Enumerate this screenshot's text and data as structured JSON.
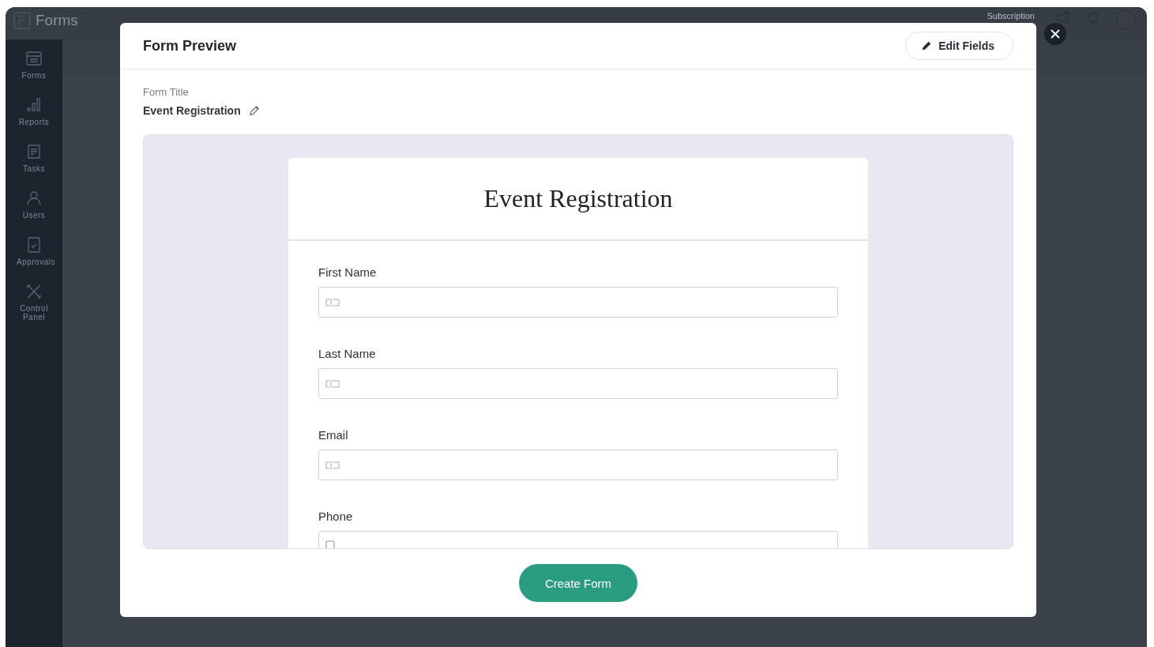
{
  "app": {
    "name": "Forms",
    "subscription": "Subscription"
  },
  "sidebar": {
    "items": [
      {
        "label": "Forms"
      },
      {
        "label": "Reports"
      },
      {
        "label": "Tasks"
      },
      {
        "label": "Users"
      },
      {
        "label": "Approvals"
      },
      {
        "label": "Control Panel"
      }
    ]
  },
  "modal": {
    "title": "Form Preview",
    "edit_button": "Edit Fields",
    "form_title_label": "Form Title",
    "form_title": "Event Registration",
    "preview": {
      "title": "Event Registration",
      "fields": [
        {
          "label": "First Name",
          "kind": "text"
        },
        {
          "label": "Last Name",
          "kind": "text"
        },
        {
          "label": "Email",
          "kind": "text"
        },
        {
          "label": "Phone",
          "kind": "phone"
        }
      ]
    },
    "create_button": "Create Form"
  }
}
